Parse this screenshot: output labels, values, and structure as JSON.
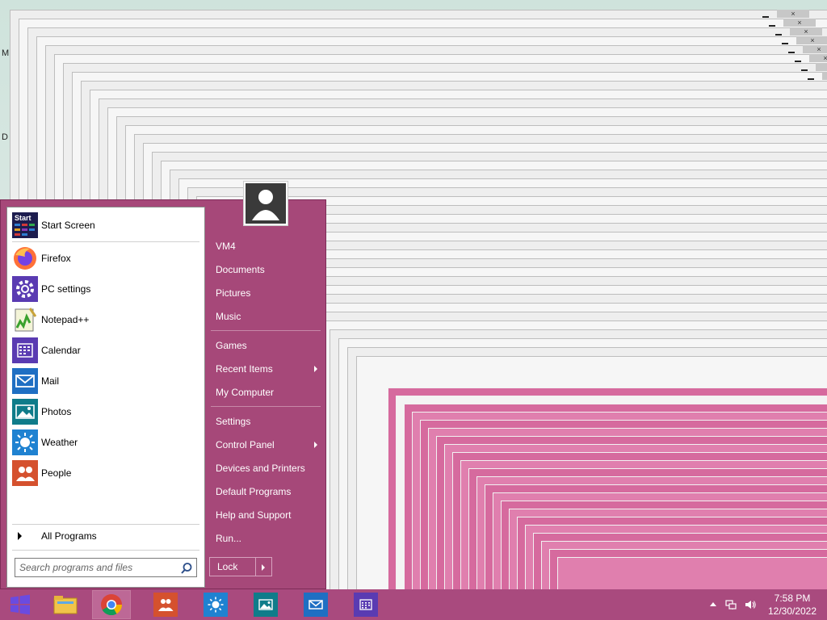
{
  "desktop": {
    "edge_letters": [
      "M",
      "D"
    ]
  },
  "start_menu": {
    "programs": [
      {
        "label": "Start Screen",
        "icon": "start-screen-icon"
      },
      {
        "label": "Firefox",
        "icon": "firefox-icon"
      },
      {
        "label": "PC settings",
        "icon": "gear-icon"
      },
      {
        "label": "Notepad++",
        "icon": "notepad-plus-plus-icon"
      },
      {
        "label": "Calendar",
        "icon": "calendar-icon"
      },
      {
        "label": "Mail",
        "icon": "mail-icon"
      },
      {
        "label": "Photos",
        "icon": "photos-icon"
      },
      {
        "label": "Weather",
        "icon": "weather-icon"
      },
      {
        "label": "People",
        "icon": "people-icon"
      }
    ],
    "start_screen_tile_text": "Start",
    "all_programs_label": "All Programs",
    "search_placeholder": "Search programs and files",
    "right_links": [
      {
        "label": "VM4"
      },
      {
        "label": "Documents"
      },
      {
        "label": "Pictures"
      },
      {
        "label": "Music"
      },
      {
        "label": "Games"
      },
      {
        "label": "Recent Items",
        "submenu": true
      },
      {
        "label": "My Computer"
      },
      {
        "label": "Settings"
      },
      {
        "label": "Control Panel",
        "submenu": true
      },
      {
        "label": "Devices and Printers"
      },
      {
        "label": "Default Programs"
      },
      {
        "label": "Help and Support"
      },
      {
        "label": "Run..."
      }
    ],
    "lock_label": "Lock"
  },
  "taskbar": {
    "apps": [
      "file-explorer-icon",
      "chrome-icon",
      "people-icon",
      "weather-icon",
      "photos-icon",
      "mail-icon",
      "calendar-icon"
    ],
    "clock_time": "7:58 PM",
    "clock_date": "12/30/2022"
  },
  "colors": {
    "accent": "#a64879",
    "taskbar": "#a94a7e",
    "window_pink": "#d86ba0"
  }
}
